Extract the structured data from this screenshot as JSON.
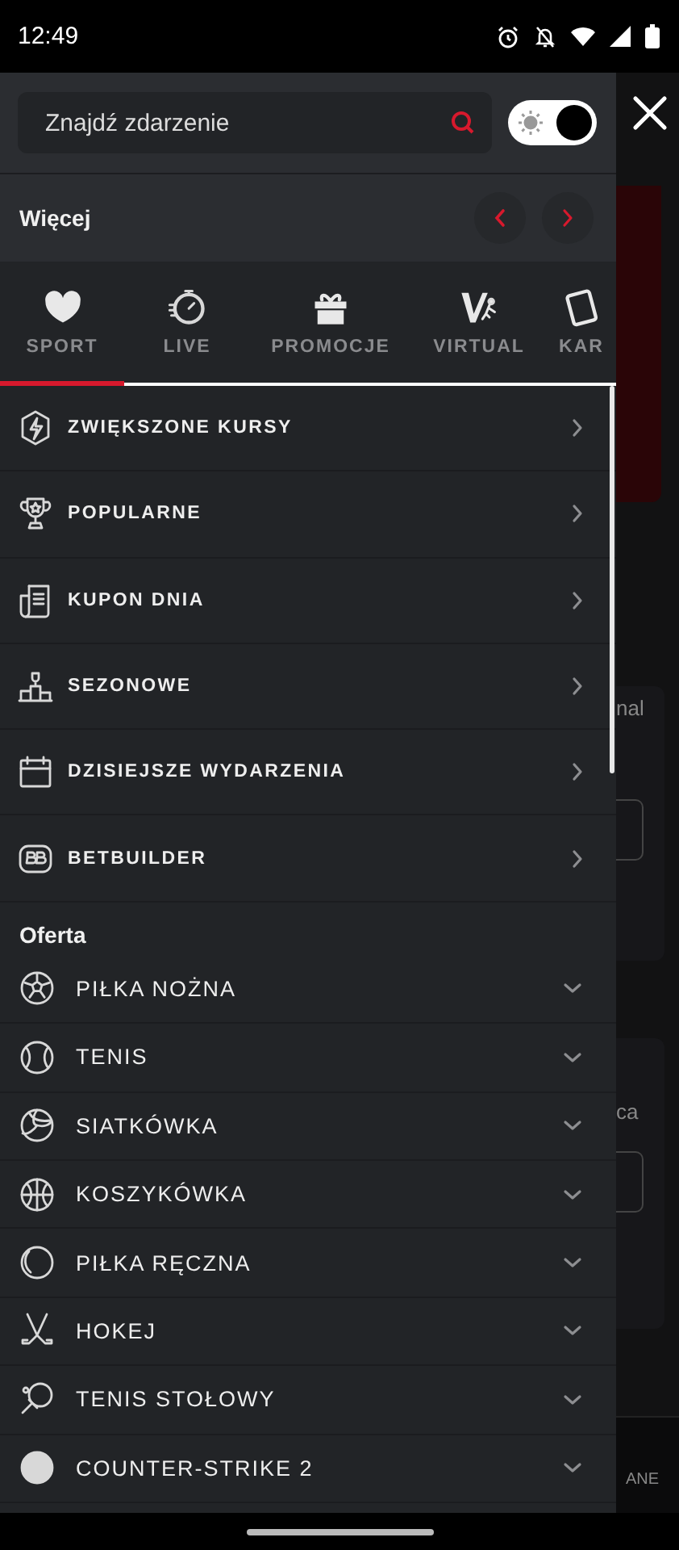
{
  "status_bar": {
    "time": "12:49"
  },
  "search": {
    "placeholder": "Znajdź zdarzenie"
  },
  "theme_toggle": {
    "checked": true
  },
  "more": {
    "title": "Więcej"
  },
  "tabs": [
    {
      "label": "SPORT",
      "selected": true
    },
    {
      "label": "LIVE",
      "selected": false
    },
    {
      "label": "PROMOCJE",
      "selected": false
    },
    {
      "label": "VIRTUAL",
      "selected": false
    },
    {
      "label": "KAR",
      "selected": false
    }
  ],
  "menu": [
    {
      "label": "ZWIĘKSZONE KURSY"
    },
    {
      "label": "POPULARNE"
    },
    {
      "label": "KUPON DNIA"
    },
    {
      "label": "SEZONOWE"
    },
    {
      "label": "DZISIEJSZE WYDARZENIA"
    },
    {
      "label": "BETBUILDER"
    }
  ],
  "offer": {
    "title": "Oferta",
    "sports": [
      {
        "label": "PIŁKA NOŻNA",
        "expanded": false
      },
      {
        "label": "TENIS",
        "expanded": false
      },
      {
        "label": "SIATKÓWKA",
        "expanded": false
      },
      {
        "label": "KOSZYKÓWKA",
        "expanded": false
      },
      {
        "label": "PIŁKA RĘCZNA",
        "expanded": false
      },
      {
        "label": "HOKEJ",
        "expanded": false
      },
      {
        "label": "TENIS STOŁOWY",
        "expanded": false
      },
      {
        "label": "COUNTER-STRIKE 2",
        "expanded": false
      }
    ]
  },
  "background": {
    "texts": [
      "nal",
      "ca",
      "ANE"
    ]
  }
}
